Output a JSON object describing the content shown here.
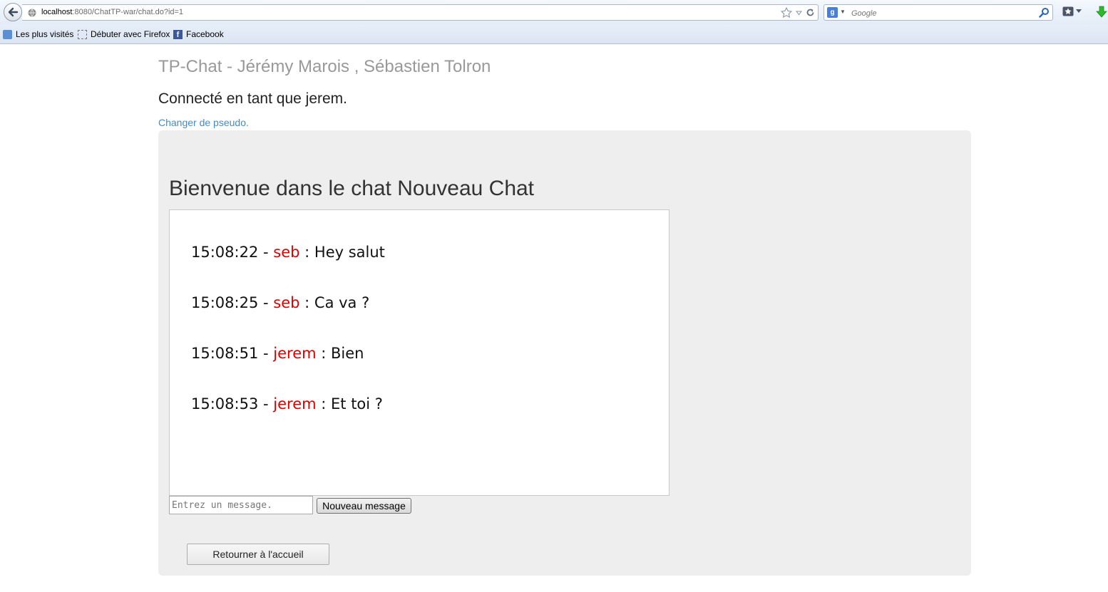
{
  "browser": {
    "url_host": "localhost",
    "url_rest": ":8080/ChatTP-war/chat.do?id=1",
    "search_placeholder": "Google",
    "icons": {
      "back": "back-arrow-icon",
      "site": "globe-icon",
      "bookmark_star": "star-icon",
      "history_dropdown": "chevron-down-icon",
      "reload": "reload-icon",
      "search_engine": "google-icon",
      "search": "magnifier-icon",
      "bookmarks_menu": "bookmarks-icon",
      "download": "download-arrow-icon"
    },
    "bookmarks": [
      {
        "label": "Les plus visités",
        "icon": "most-visited-icon"
      },
      {
        "label": "Débuter avec Firefox",
        "icon": "blank-page-icon"
      },
      {
        "label": "Facebook",
        "icon": "facebook-icon"
      }
    ]
  },
  "page": {
    "site_title": "TP-Chat - Jérémy Marois , Sébastien Tolron",
    "connected_text": "Connecté en tant que jerem.",
    "change_nickname_link": "Changer de pseudo."
  },
  "chat": {
    "heading": "Bienvenue dans le chat Nouveau Chat",
    "messages": [
      {
        "time": "15:08:22",
        "author": "seb",
        "text": "Hey salut"
      },
      {
        "time": "15:08:25",
        "author": "seb",
        "text": "Ca va ?"
      },
      {
        "time": "15:08:51",
        "author": "jerem",
        "text": "Bien"
      },
      {
        "time": "15:08:53",
        "author": "jerem",
        "text": "Et toi ?"
      }
    ],
    "separator_time": " - ",
    "separator_author": " : ",
    "input_placeholder": "Entrez un message.",
    "send_label": "Nouveau message",
    "home_label": "Retourner à l'accueil"
  },
  "colors": {
    "author": "#dd0000",
    "link": "#428bca",
    "panel": "#eeeeee",
    "title": "#999999"
  }
}
